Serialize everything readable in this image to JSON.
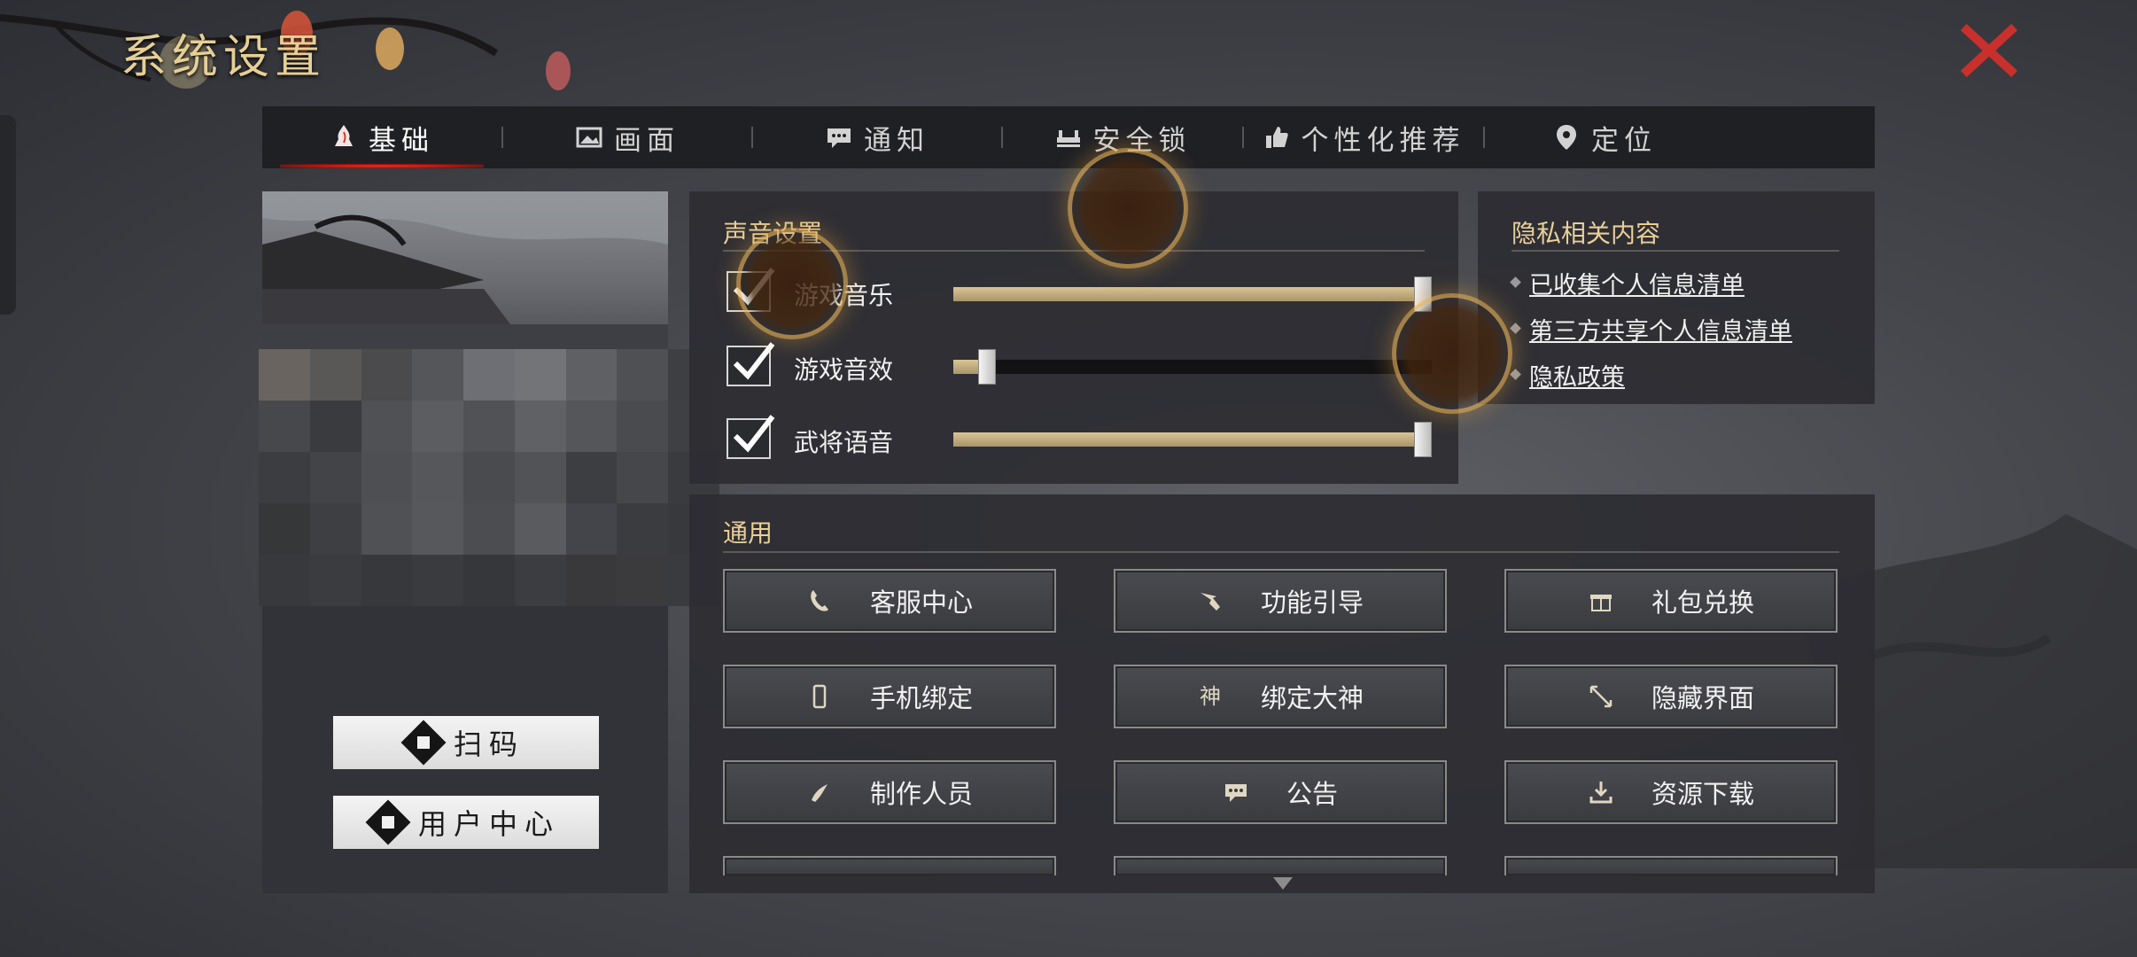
{
  "title": "系统设置",
  "tabs": [
    {
      "label": "基础",
      "icon": "flame-hand-icon",
      "active": true
    },
    {
      "label": "画面",
      "icon": "picture-icon",
      "active": false
    },
    {
      "label": "通知",
      "icon": "chat-bubble-icon",
      "active": false
    },
    {
      "label": "安全锁",
      "icon": "lock-bench-icon",
      "active": false
    },
    {
      "label": "个性化推荐",
      "icon": "thumbs-up-icon",
      "active": false
    },
    {
      "label": "定位",
      "icon": "map-pin-icon",
      "active": false
    }
  ],
  "left_panel": {
    "scan_label": "扫码",
    "user_center_label": "用户中心"
  },
  "sound": {
    "title": "声音设置",
    "rows": [
      {
        "label": "游戏音乐",
        "checked": true,
        "level": 1.0
      },
      {
        "label": "游戏音效",
        "checked": true,
        "level": 0.07
      },
      {
        "label": "武将语音",
        "checked": true,
        "level": 1.0
      }
    ]
  },
  "privacy": {
    "title": "隐私相关内容",
    "links": [
      "已收集个人信息清单",
      "第三方共享个人信息清单",
      "隐私政策"
    ]
  },
  "general": {
    "title": "通用",
    "buttons": [
      {
        "label": "客服中心",
        "icon": "phone-icon"
      },
      {
        "label": "功能引导",
        "icon": "pointing-hand-icon"
      },
      {
        "label": "礼包兑换",
        "icon": "gift-icon"
      },
      {
        "label": "手机绑定",
        "icon": "mobile-phone-icon"
      },
      {
        "label": "绑定大神",
        "icon": "shen-character-icon",
        "icon_text": "神"
      },
      {
        "label": "隐藏界面",
        "icon": "expand-arrows-icon"
      },
      {
        "label": "制作人员",
        "icon": "brush-stroke-icon"
      },
      {
        "label": "公告",
        "icon": "speech-bubble-icon"
      },
      {
        "label": "资源下载",
        "icon": "download-icon"
      }
    ]
  },
  "colors": {
    "accent_gold": "#e9cf98",
    "tab_active_red": "#e0281a",
    "close_red": "#c9302c",
    "slider_fill": "#cbb688"
  }
}
